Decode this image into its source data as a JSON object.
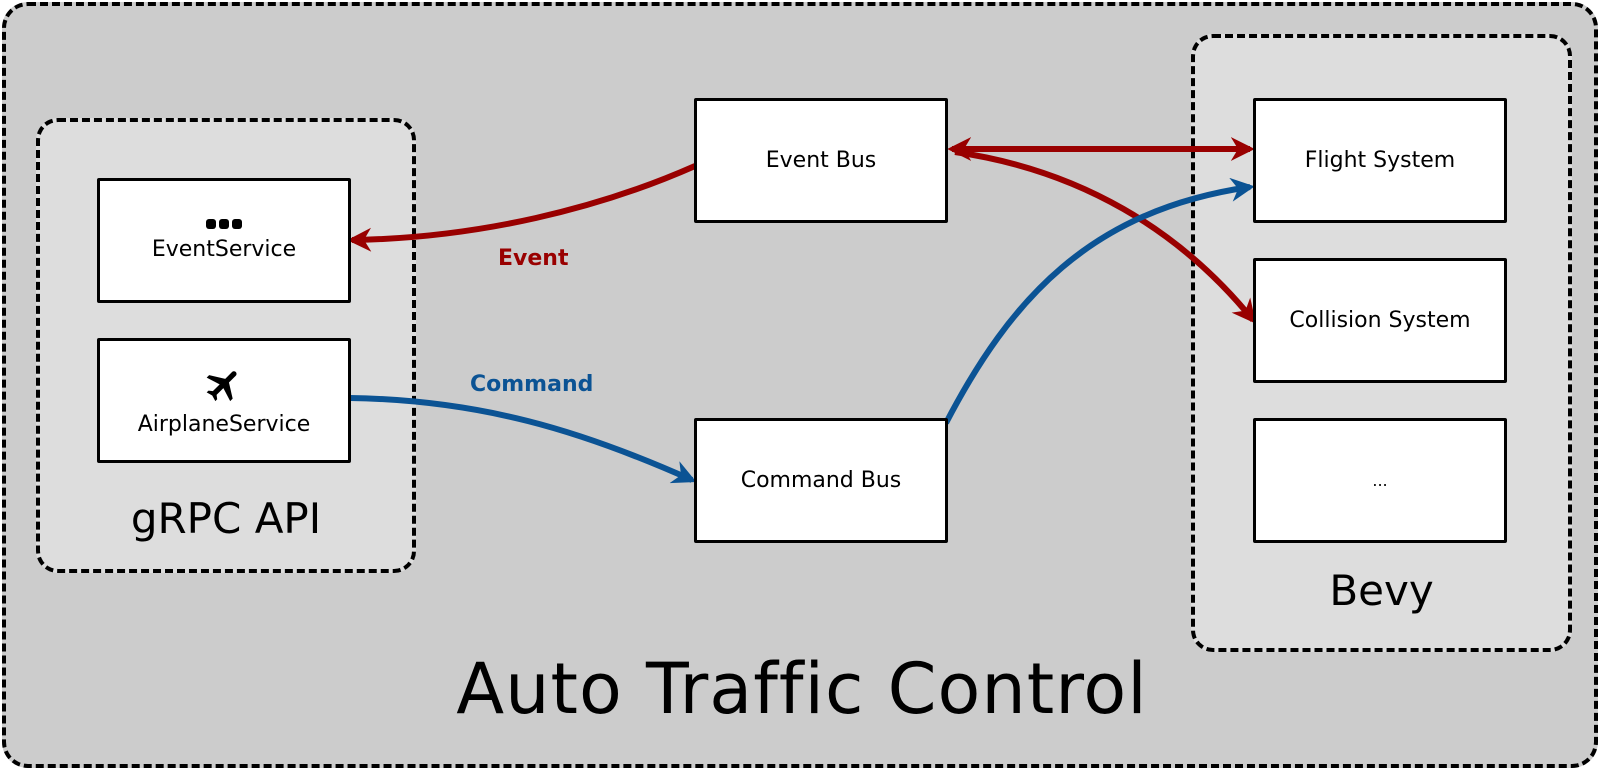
{
  "title": "Auto Traffic Control",
  "groups": {
    "grpc": {
      "label": "gRPC API"
    },
    "bevy": {
      "label": "Bevy"
    }
  },
  "nodes": {
    "event_service": {
      "label": "EventService",
      "icon": "more-horizontal-icon"
    },
    "airplane_service": {
      "label": "AirplaneService",
      "icon": "airplane-icon"
    },
    "event_bus": {
      "label": "Event Bus"
    },
    "command_bus": {
      "label": "Command Bus"
    },
    "flight_system": {
      "label": "Flight System"
    },
    "collision_system": {
      "label": "Collision System"
    },
    "more_systems": {
      "label": "..."
    }
  },
  "edges": [
    {
      "from": "Event Bus",
      "to": "EventService",
      "label": "Event",
      "color": "#990000"
    },
    {
      "from": "AirplaneService",
      "to": "Command Bus",
      "label": "Command",
      "color": "#0b5394"
    },
    {
      "from": "Event Bus",
      "to": "Flight System",
      "bidirectional": true,
      "color": "#990000"
    },
    {
      "from": "Event Bus",
      "to": "Collision System",
      "bidirectional": true,
      "color": "#990000"
    },
    {
      "from": "Command Bus",
      "to": "Flight System",
      "color": "#0b5394"
    }
  ],
  "colors": {
    "event": "#990000",
    "command": "#0b5394",
    "outer_bg": "#cccccc",
    "group_bg": "#dddddd"
  }
}
